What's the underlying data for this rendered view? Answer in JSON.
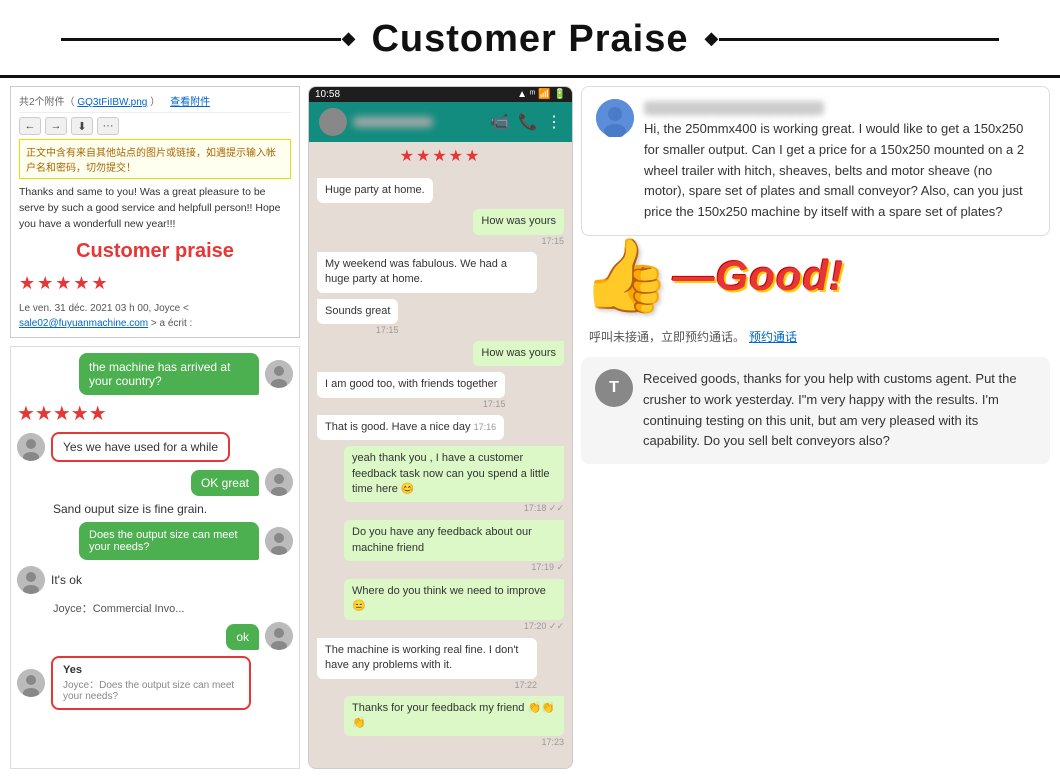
{
  "header": {
    "title": "Customer Praise"
  },
  "left": {
    "email": {
      "attachments": "共2个附件（",
      "attachment_name": "GQ3tFiIBW.png",
      "attachment_suffix": "）",
      "view_link": "查看附件",
      "warning": "正文中含有来自其他站点的图片或链接，如遇提示输入帐户名和密码，切勿提交！",
      "body_text": "Thanks and same to you! Was a great pleasure to be serve by such a good service and helpfull person!! Hope you have a wonderfull new year!!!",
      "praise_label": "Customer praise",
      "from_text": "Le ven. 31 déc. 2021 03 h 00, Joyce <",
      "email_address": "sale02@fuyuanmachine.com",
      "from_suffix": "> a écrit :"
    },
    "chat": {
      "question": "the machine has arrived at your country?",
      "stars_count": 5,
      "answer_used": "Yes we have used for a while",
      "answer_ok": "OK great",
      "plain_text": "Sand ouput size is fine grain.",
      "question2": "Does the output size can meet your needs?",
      "answer_ok2": "It's ok",
      "file_text": "Joyce：Commercial Invo...",
      "answer_ok3": "ok",
      "answer_yes": "Yes",
      "sub_text": "Joyce：Does the output size can meet your needs?"
    }
  },
  "middle": {
    "time": "10:58",
    "status_icons": "▲ WiFi 📶 🔋",
    "stars_count": 5,
    "messages": [
      {
        "type": "received",
        "text": "Huge party at home.",
        "time": ""
      },
      {
        "type": "sent",
        "text": "How was yours",
        "time": "17:15"
      },
      {
        "type": "received",
        "text": "My weekend was fabulous. We had a huge party at home.",
        "time": ""
      },
      {
        "type": "received",
        "text": "Sounds great",
        "time": "17:15"
      },
      {
        "type": "sent",
        "text": "How was yours",
        "time": ""
      },
      {
        "type": "received",
        "text": "I am good too, with friends together",
        "time": "17:15"
      },
      {
        "type": "received",
        "text": "That is good. Have a nice day",
        "time": "17:16"
      },
      {
        "type": "sent",
        "text": "yeah thank you , I have a customer feedback task now can you spend a little time here 😊",
        "time": "17:18"
      },
      {
        "type": "sent",
        "text": "Do you have any feedback about our machine friend",
        "time": "17:19"
      },
      {
        "type": "sent",
        "text": "Where do you think we need to improve 😑",
        "time": "17:20"
      },
      {
        "type": "received",
        "text": "The machine is working real fine. I don't have any problems with it.",
        "time": "17:22"
      },
      {
        "type": "sent",
        "text": "Thanks for your feedback my friend",
        "time": "17:23"
      }
    ]
  },
  "right": {
    "blurred_name": "██████████████████████",
    "main_message": "Hi, the 250mmx400 is working great. I would like to get a 150x250 for smaller output. Can I get a price for a 150x250 mounted on a 2 wheel trailer with hitch, sheaves, belts and motor sheave (no motor), spare set of plates and small conveyor? Also, can you just price the 150x250 machine by itself with a spare set of plates?",
    "good_label": "—Good!",
    "chinese_text1": "呼叫未接通，立即预约通话。",
    "chinese_link": "预约通话",
    "received_message": "Received goods, thanks for you help with customs agent. Put the crusher to work yesterday. I\"m very happy with the results. I'm continuing testing on this unit, but am very pleased with its capability. Do you sell belt conveyors also?"
  }
}
